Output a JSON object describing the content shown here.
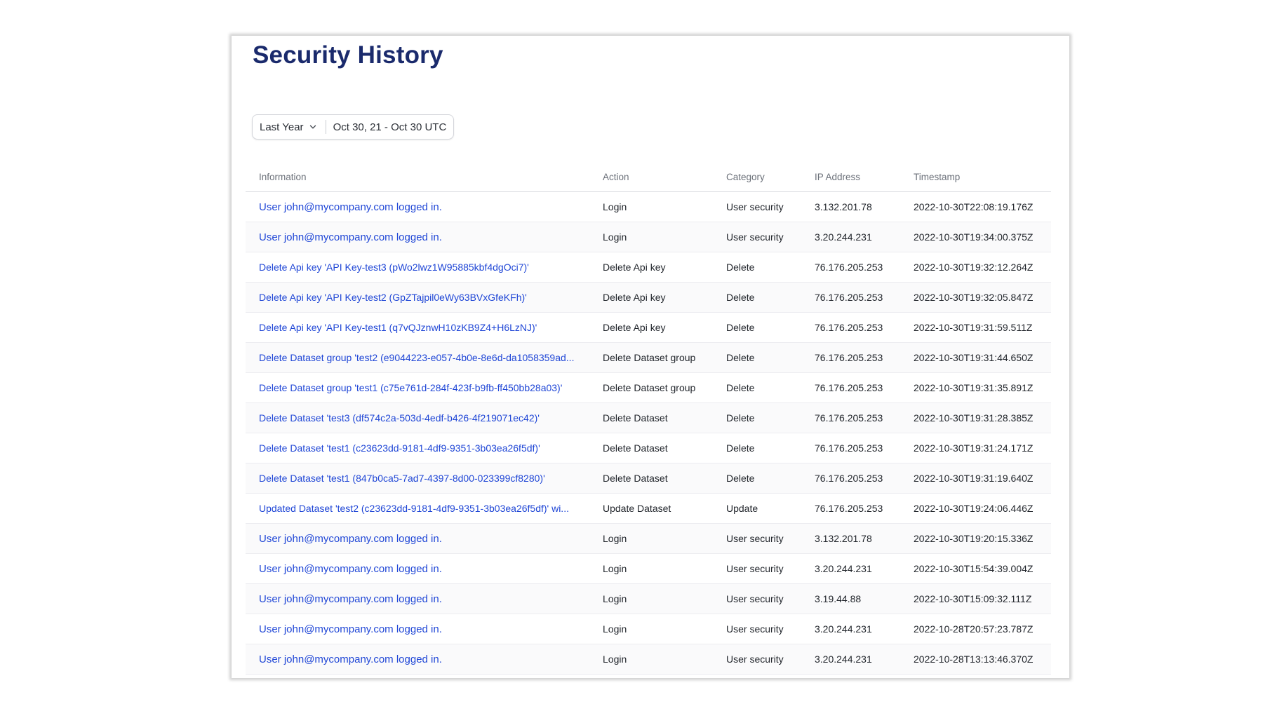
{
  "page": {
    "title": "Security History"
  },
  "filter": {
    "period_label": "Last Year",
    "range_label": "Oct 30, 21 - Oct 30 UTC",
    "chevron_icon": "chevron-down-icon"
  },
  "table": {
    "headers": {
      "information": "Information",
      "action": "Action",
      "category": "Category",
      "ip": "IP Address",
      "timestamp": "Timestamp"
    },
    "rows": [
      {
        "info": "User john@mycompany.com logged in.",
        "action": "Login",
        "category": "User security",
        "ip": "3.132.201.78",
        "timestamp": "2022-10-30T22:08:19.176Z"
      },
      {
        "info": "User john@mycompany.com logged in.",
        "action": "Login",
        "category": "User security",
        "ip": "3.20.244.231",
        "timestamp": "2022-10-30T19:34:00.375Z"
      },
      {
        "info": "Delete Api key 'API Key-test3 (pWo2lwz1W95885kbf4dgOci7)'",
        "action": "Delete Api key",
        "category": "Delete",
        "ip": "76.176.205.253",
        "timestamp": "2022-10-30T19:32:12.264Z"
      },
      {
        "info": "Delete Api key 'API Key-test2 (GpZTajpil0eWy63BVxGfeKFh)'",
        "action": "Delete Api key",
        "category": "Delete",
        "ip": "76.176.205.253",
        "timestamp": "2022-10-30T19:32:05.847Z"
      },
      {
        "info": "Delete Api key 'API Key-test1 (q7vQJznwH10zKB9Z4+H6LzNJ)'",
        "action": "Delete Api key",
        "category": "Delete",
        "ip": "76.176.205.253",
        "timestamp": "2022-10-30T19:31:59.511Z"
      },
      {
        "info": "Delete Dataset group 'test2 (e9044223-e057-4b0e-8e6d-da1058359ad...",
        "action": "Delete Dataset group",
        "category": "Delete",
        "ip": "76.176.205.253",
        "timestamp": "2022-10-30T19:31:44.650Z"
      },
      {
        "info": "Delete Dataset group 'test1 (c75e761d-284f-423f-b9fb-ff450bb28a03)'",
        "action": "Delete Dataset group",
        "category": "Delete",
        "ip": "76.176.205.253",
        "timestamp": "2022-10-30T19:31:35.891Z"
      },
      {
        "info": "Delete Dataset 'test3 (df574c2a-503d-4edf-b426-4f219071ec42)'",
        "action": "Delete Dataset",
        "category": "Delete",
        "ip": "76.176.205.253",
        "timestamp": "2022-10-30T19:31:28.385Z"
      },
      {
        "info": "Delete Dataset 'test1 (c23623dd-9181-4df9-9351-3b03ea26f5df)'",
        "action": "Delete Dataset",
        "category": "Delete",
        "ip": "76.176.205.253",
        "timestamp": "2022-10-30T19:31:24.171Z"
      },
      {
        "info": "Delete Dataset 'test1 (847b0ca5-7ad7-4397-8d00-023399cf8280)'",
        "action": "Delete Dataset",
        "category": "Delete",
        "ip": "76.176.205.253",
        "timestamp": "2022-10-30T19:31:19.640Z"
      },
      {
        "info": "Updated Dataset 'test2 (c23623dd-9181-4df9-9351-3b03ea26f5df)' wi...",
        "action": "Update Dataset",
        "category": "Update",
        "ip": "76.176.205.253",
        "timestamp": "2022-10-30T19:24:06.446Z"
      },
      {
        "info": "User john@mycompany.com logged in.",
        "action": "Login",
        "category": "User security",
        "ip": "3.132.201.78",
        "timestamp": "2022-10-30T19:20:15.336Z"
      },
      {
        "info": "User john@mycompany.com logged in.",
        "action": "Login",
        "category": "User security",
        "ip": "3.20.244.231",
        "timestamp": "2022-10-30T15:54:39.004Z"
      },
      {
        "info": "User john@mycompany.com logged in.",
        "action": "Login",
        "category": "User security",
        "ip": "3.19.44.88",
        "timestamp": "2022-10-30T15:09:32.111Z"
      },
      {
        "info": "User john@mycompany.com logged in.",
        "action": "Login",
        "category": "User security",
        "ip": "3.20.244.231",
        "timestamp": "2022-10-28T20:57:23.787Z"
      },
      {
        "info": "User john@mycompany.com logged in.",
        "action": "Login",
        "category": "User security",
        "ip": "3.20.244.231",
        "timestamp": "2022-10-28T13:13:46.370Z"
      }
    ]
  }
}
